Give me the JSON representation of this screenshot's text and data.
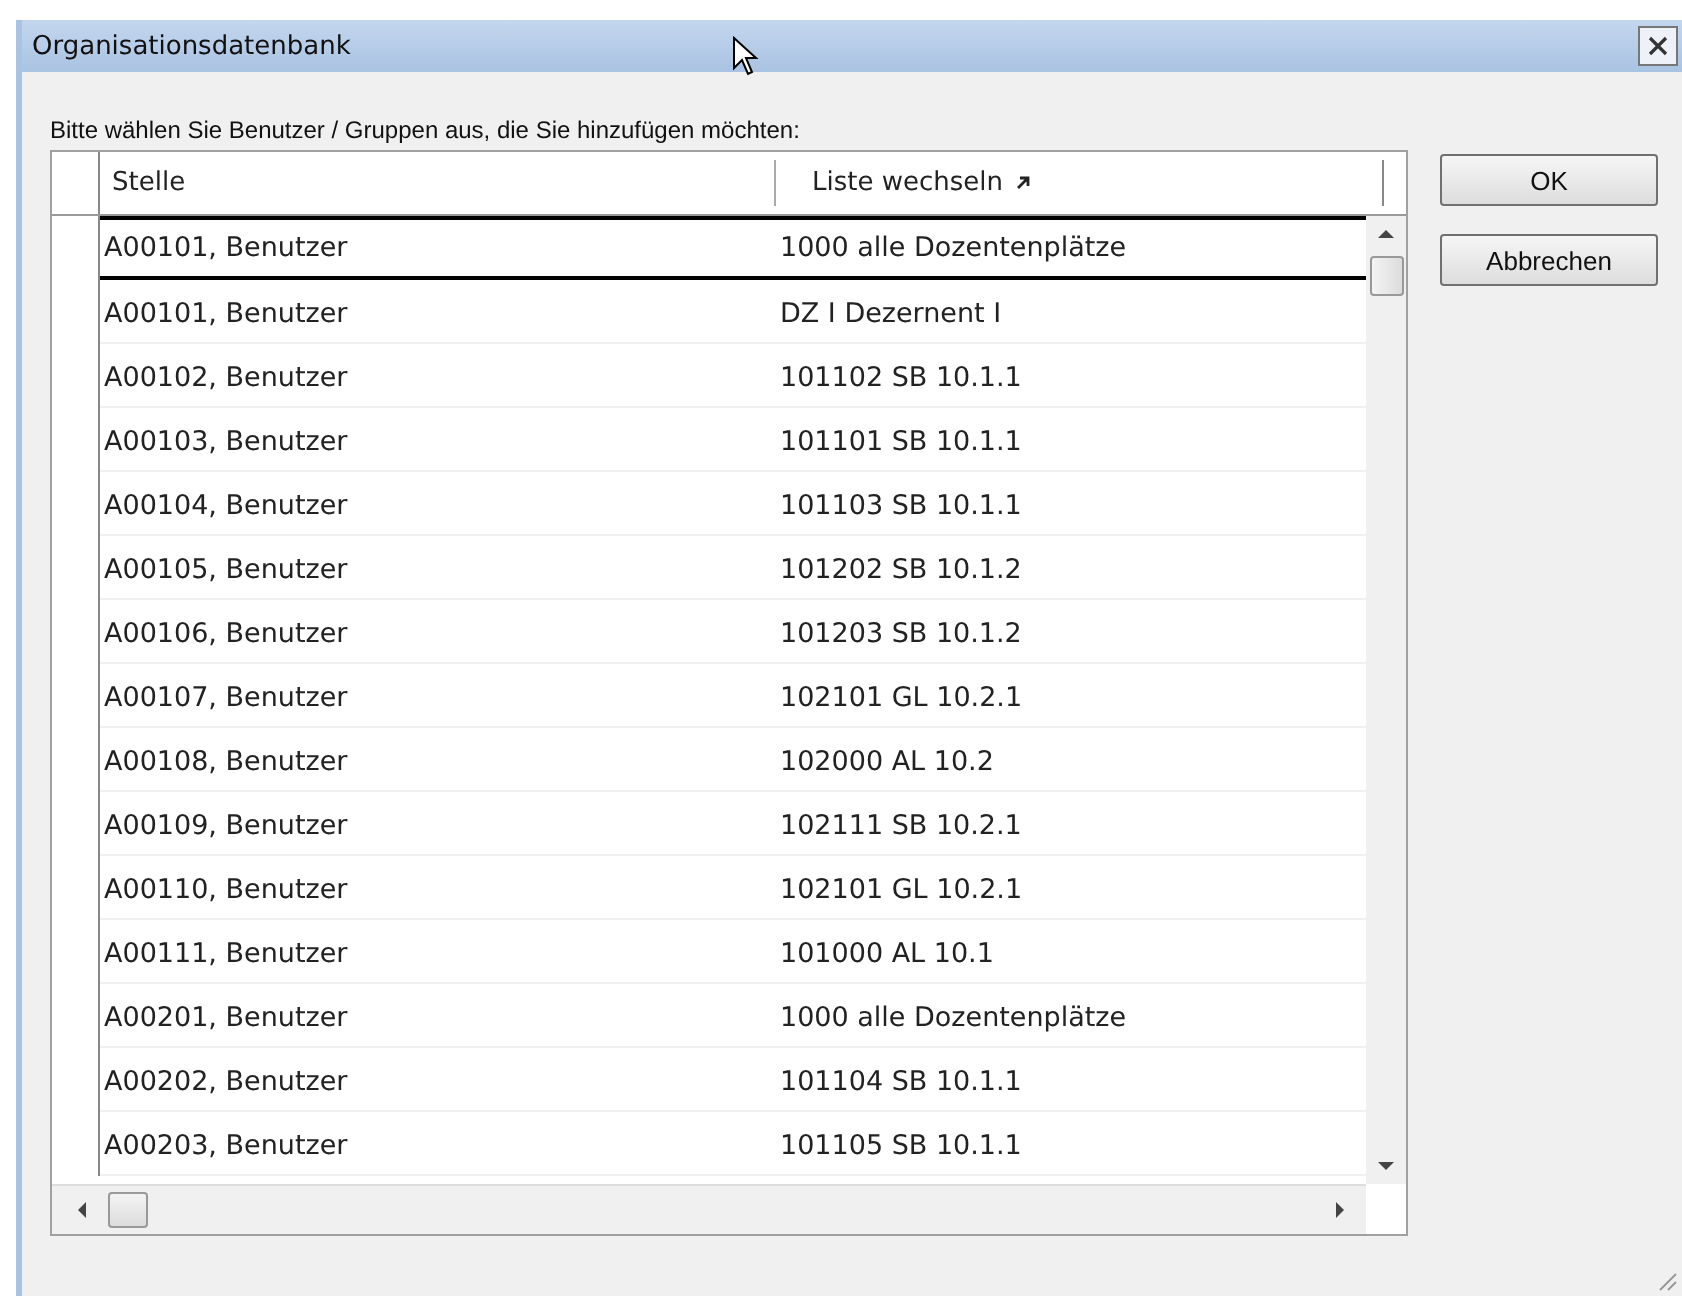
{
  "window": {
    "title": "Organisationsdatenbank"
  },
  "prompt": "Bitte wählen Sie Benutzer / Gruppen aus, die Sie hinzufügen möchten:",
  "table": {
    "columns": [
      "Stelle",
      "Liste wechseln"
    ],
    "rows": [
      {
        "cells": [
          "A00101, Benutzer",
          "1000 alle Dozentenplätze"
        ],
        "selected": true
      },
      {
        "cells": [
          "A00101, Benutzer",
          "DZ I Dezernent I"
        ],
        "selected": false
      },
      {
        "cells": [
          "A00102, Benutzer",
          "101102 SB 10.1.1"
        ],
        "selected": false
      },
      {
        "cells": [
          "A00103, Benutzer",
          "101101 SB 10.1.1"
        ],
        "selected": false
      },
      {
        "cells": [
          "A00104, Benutzer",
          "101103 SB 10.1.1"
        ],
        "selected": false
      },
      {
        "cells": [
          "A00105, Benutzer",
          "101202 SB 10.1.2"
        ],
        "selected": false
      },
      {
        "cells": [
          "A00106, Benutzer",
          "101203 SB 10.1.2"
        ],
        "selected": false
      },
      {
        "cells": [
          "A00107, Benutzer",
          "102101 GL 10.2.1"
        ],
        "selected": false
      },
      {
        "cells": [
          "A00108, Benutzer",
          "102000 AL 10.2"
        ],
        "selected": false
      },
      {
        "cells": [
          "A00109, Benutzer",
          "102111 SB 10.2.1"
        ],
        "selected": false
      },
      {
        "cells": [
          "A00110, Benutzer",
          "102101 GL 10.2.1"
        ],
        "selected": false
      },
      {
        "cells": [
          "A00111, Benutzer",
          "101000 AL 10.1"
        ],
        "selected": false
      },
      {
        "cells": [
          "A00201, Benutzer",
          "1000 alle Dozentenplätze"
        ],
        "selected": false
      },
      {
        "cells": [
          "A00202, Benutzer",
          "101104 SB 10.1.1"
        ],
        "selected": false
      },
      {
        "cells": [
          "A00203, Benutzer",
          "101105 SB 10.1.1"
        ],
        "selected": false
      }
    ]
  },
  "buttons": [
    "OK",
    "Abbrechen"
  ]
}
